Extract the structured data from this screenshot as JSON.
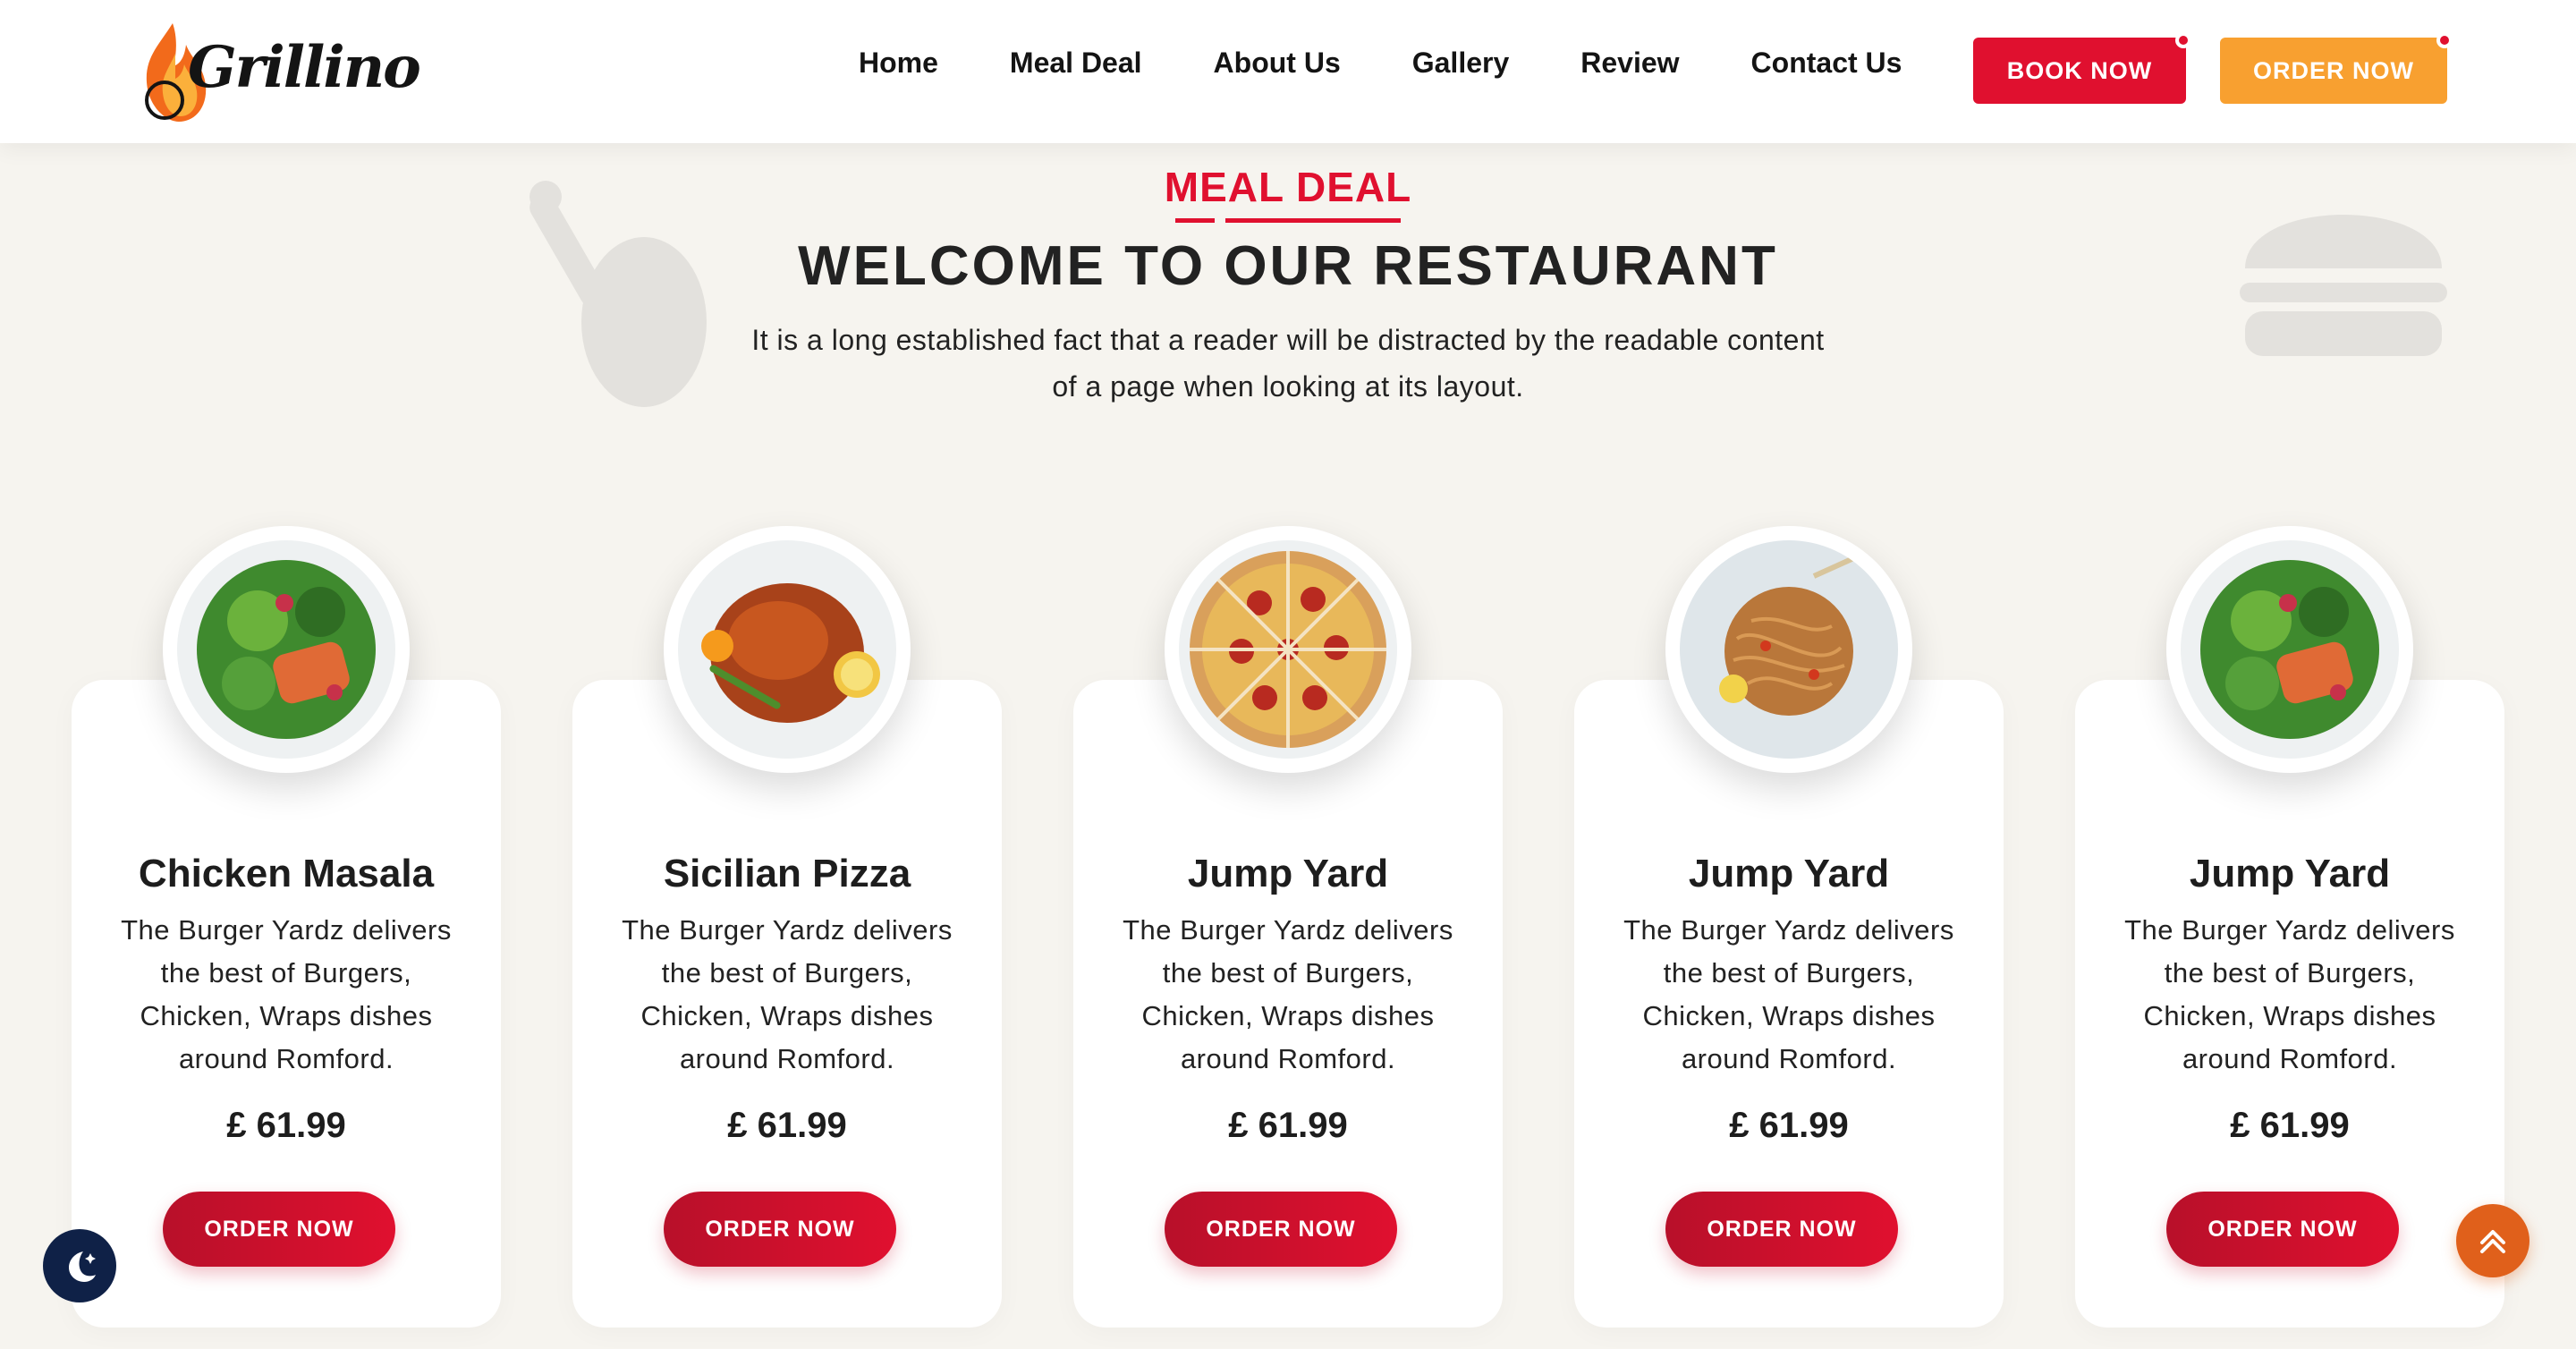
{
  "brand": {
    "name": "Grillino",
    "colors": {
      "primary": "#e0102f",
      "secondary": "#f8a030",
      "dark": "#141414",
      "background": "#f6f4ef"
    }
  },
  "nav": {
    "items": [
      "Home",
      "Meal Deal",
      "About Us",
      "Gallery",
      "Review",
      "Contact Us"
    ],
    "book_label": "BOOK NOW",
    "order_label": "ORDER NOW"
  },
  "section": {
    "tag": "MEAL DEAL",
    "title": "WELCOME TO OUR RESTAURANT",
    "description": "It is a long established fact that a reader will be distracted by the readable content of a page when looking at its layout."
  },
  "cards": [
    {
      "title": "Chicken Masala",
      "description": "The Burger Yardz delivers the best of Burgers, Chicken, Wraps dishes around Romford.",
      "price": "£ 61.99",
      "button": "ORDER NOW",
      "image_icon": "salad-plate-icon"
    },
    {
      "title": "Sicilian Pizza",
      "description": "The Burger Yardz delivers the best of Burgers, Chicken, Wraps dishes around Romford.",
      "price": "£ 61.99",
      "button": "ORDER NOW",
      "image_icon": "roast-chicken-plate-icon"
    },
    {
      "title": "Jump Yard",
      "description": "The Burger Yardz delivers the best of Burgers, Chicken, Wraps dishes around Romford.",
      "price": "£ 61.99",
      "button": "ORDER NOW",
      "image_icon": "pizza-plate-icon"
    },
    {
      "title": "Jump Yard",
      "description": "The Burger Yardz delivers the best of Burgers, Chicken, Wraps dishes around Romford.",
      "price": "£ 61.99",
      "button": "ORDER NOW",
      "image_icon": "noodles-plate-icon"
    },
    {
      "title": "Jump Yard",
      "description": "The Burger Yardz delivers the best of Burgers, Chicken, Wraps dishes around Romford.",
      "price": "£ 61.99",
      "button": "ORDER NOW",
      "image_icon": "salad-plate-icon"
    }
  ],
  "floating": {
    "theme_icon": "moon-icon",
    "scroll_icon": "double-chevron-up-icon"
  }
}
